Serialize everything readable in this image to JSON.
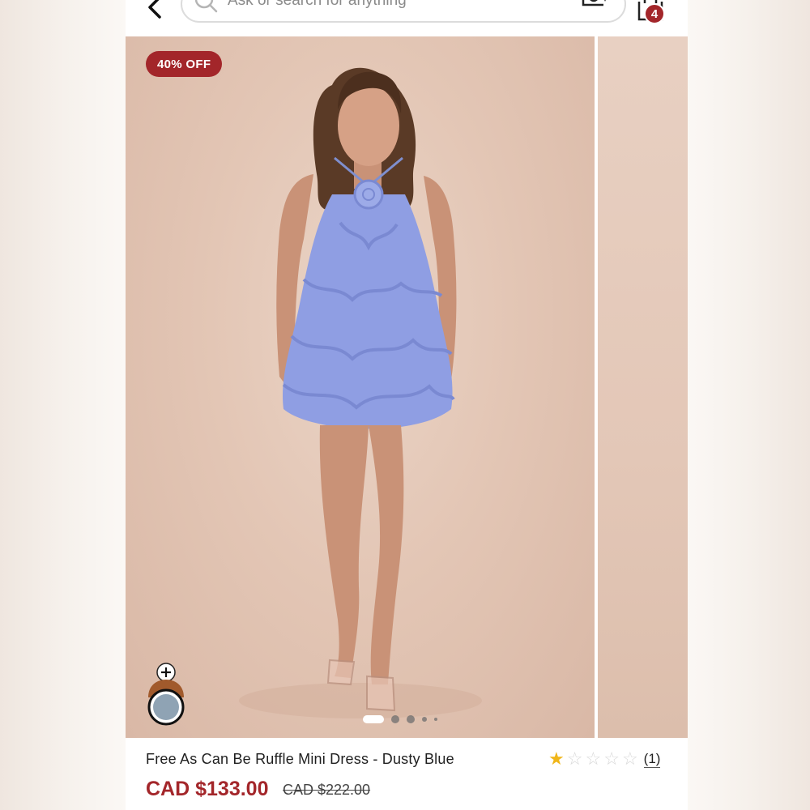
{
  "header": {
    "search_placeholder": "Ask or search for anything",
    "cart_count": "4"
  },
  "gallery": {
    "discount_badge": "40% OFF",
    "slide_count": 5,
    "active_slide": 1
  },
  "product": {
    "title": "Free As Can Be Ruffle Mini Dress - Dusty Blue",
    "rating_stars": 1,
    "rating_max": 5,
    "review_count": "(1)",
    "price_now": "CAD $133.00",
    "price_was": "CAD $222.00",
    "selected_color_hex": "#8fa3b4"
  },
  "colors": {
    "brand": "#a3262a",
    "star": "#f0b619",
    "dress": "#8f9ee3"
  },
  "icons": [
    "back-arrow-icon",
    "search-icon",
    "camera-search-icon",
    "shopping-bag-icon",
    "plus-icon",
    "star-icon"
  ]
}
